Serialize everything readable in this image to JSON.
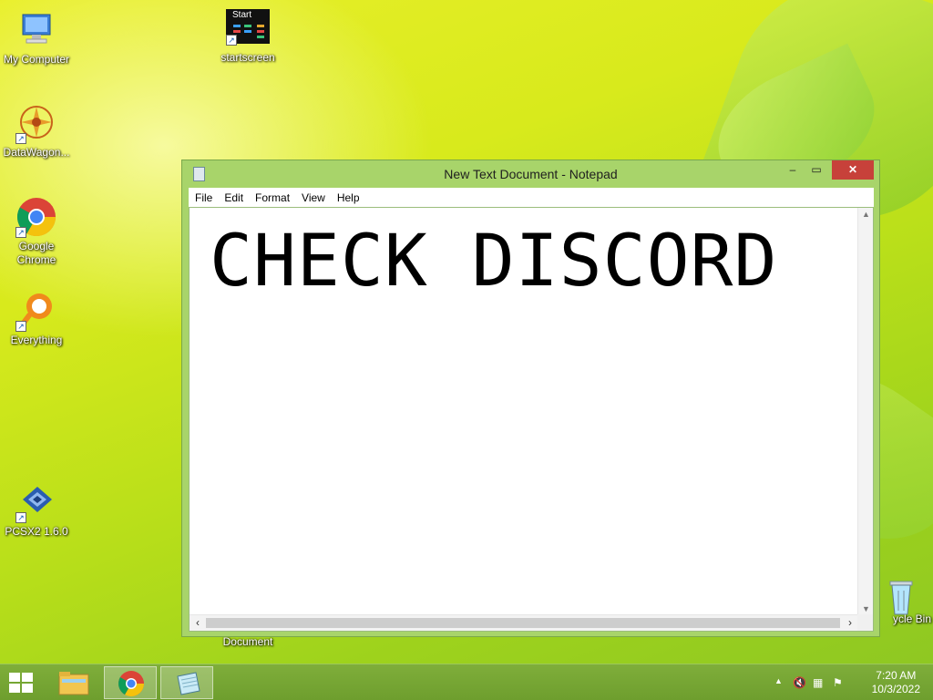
{
  "desktop": {
    "icons": [
      {
        "label": "My Computer"
      },
      {
        "label": "startscreen",
        "tile_text": "Start"
      },
      {
        "label": "DataWagon..."
      },
      {
        "label": "Google Chrome"
      },
      {
        "label": "Everything"
      },
      {
        "label": "PCSX2 1.6.0"
      },
      {
        "label": "Document"
      },
      {
        "label": "ycle Bin"
      }
    ]
  },
  "window": {
    "title": "New Text Document - Notepad",
    "controls": {
      "minimize": "–",
      "maximize": "▭",
      "close": "✕"
    },
    "menu": [
      "File",
      "Edit",
      "Format",
      "View",
      "Help"
    ],
    "content": "CHECK DISCORD"
  },
  "taskbar": {
    "clock_time": "7:20 AM",
    "clock_date": "10/3/2022",
    "accent": "#6e9e2e"
  }
}
